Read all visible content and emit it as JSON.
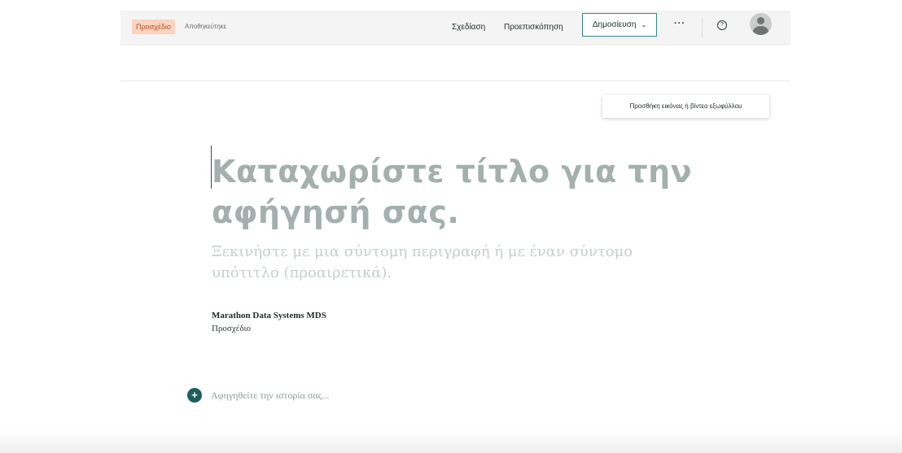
{
  "topbar": {
    "draft_badge": "Προσχέδιο",
    "saved_status": "Αποθηκεύτηκε",
    "design_label": "Σχεδίαση",
    "preview_label": "Προεπισκόπηση",
    "publish_label": "Δημοσίευση",
    "more_label": "···",
    "help_label": "?",
    "icons": {
      "publish_dropdown": "chevron-down-icon",
      "help": "question-circle-icon",
      "avatar": "user-avatar-icon"
    }
  },
  "cover": {
    "button_label": "Προσθήκη εικόνας ή βίντεο εξωφύλλου"
  },
  "editor": {
    "title_placeholder": "Καταχωρίστε τίτλο για την αφήγησή σας.",
    "subtitle_placeholder": "Ξεκινήστε με μια σύντομη περιγραφή ή με έναν σύντομο υπότιτλο (προαιρετικά).",
    "author_name": "Marathon Data Systems MDS",
    "author_status": "Προσχέδιο",
    "add_block_icon": "+",
    "body_placeholder": "Αφηγηθείτε την ιστορία σας..."
  },
  "colors": {
    "accent": "#1e5f5c",
    "publish_border": "#2f8b87",
    "draft_badge_bg": "#fbd3bf",
    "draft_badge_text": "#b4532a",
    "title_placeholder": "#a3b0ad",
    "subtitle_placeholder": "#c6cfcd"
  }
}
